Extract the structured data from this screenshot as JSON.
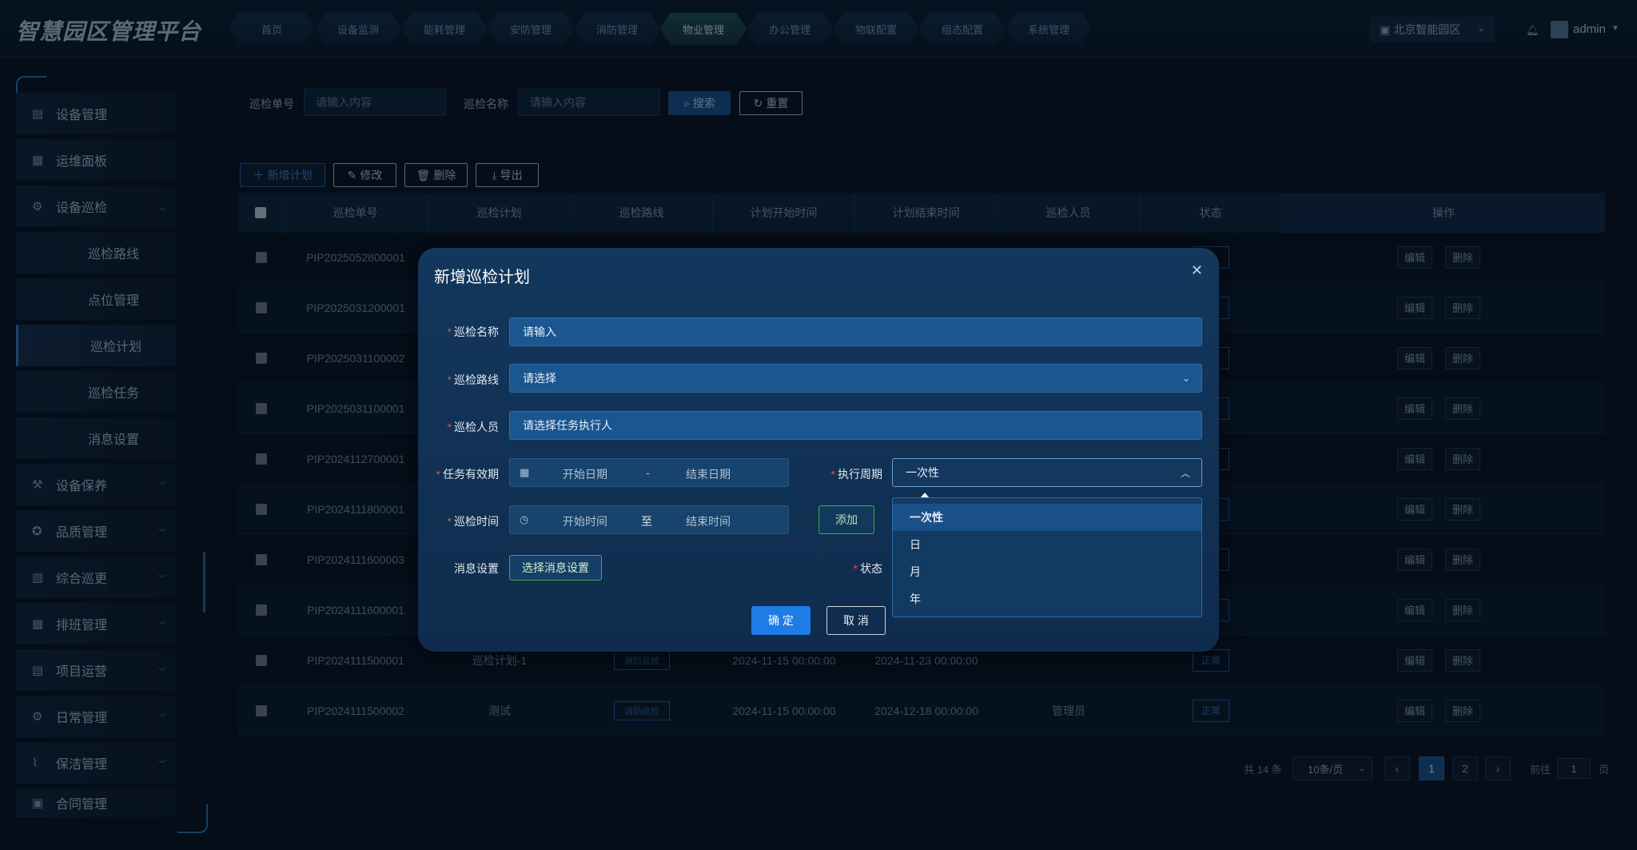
{
  "app": {
    "title": "智慧园区管理平台"
  },
  "nav": {
    "tabs": [
      "首页",
      "设备监测",
      "能耗管理",
      "安防管理",
      "消防管理",
      "物业管理",
      "办公管理",
      "物联配置",
      "组态配置",
      "系统管理"
    ],
    "active_index": 5
  },
  "header": {
    "region": "北京智能园区",
    "user": "admin"
  },
  "sidebar": {
    "items": [
      {
        "label": "设备管理",
        "icon": "server-icon"
      },
      {
        "label": "运维面板",
        "icon": "chart-icon"
      },
      {
        "label": "设备巡检",
        "icon": "gear-icon"
      },
      {
        "label": "巡检路线"
      },
      {
        "label": "点位管理"
      },
      {
        "label": "巡检计划"
      },
      {
        "label": "巡检任务"
      },
      {
        "label": "消息设置"
      },
      {
        "label": "设备保养",
        "icon": "wrench-icon"
      },
      {
        "label": "品质管理",
        "icon": "badge-icon"
      },
      {
        "label": "综合巡更",
        "icon": "building-icon"
      },
      {
        "label": "排班管理",
        "icon": "calendar-icon"
      },
      {
        "label": "项目运营",
        "icon": "chart-icon"
      },
      {
        "label": "日常管理",
        "icon": "cog-icon"
      },
      {
        "label": "保洁管理",
        "icon": "broom-icon"
      },
      {
        "label": "合同管理",
        "icon": "contract-icon"
      }
    ]
  },
  "filters": {
    "code_label": "巡检单号",
    "code_placeholder": "请输入内容",
    "name_label": "巡检名称",
    "name_placeholder": "请输入内容",
    "search": "搜索",
    "reset": "重置"
  },
  "toolbar": {
    "add": "新增计划",
    "edit": "修改",
    "delete": "删除",
    "export": "导出"
  },
  "table": {
    "headers": [
      "巡检单号",
      "巡检计划",
      "巡检路线",
      "计划开始时间",
      "计划结束时间",
      "巡检人员",
      "状态",
      "操作"
    ],
    "rows": [
      {
        "code": "PIP2025052800001"
      },
      {
        "code": "PIP2025031200001"
      },
      {
        "code": "PIP2025031100002"
      },
      {
        "code": "PIP2025031100001"
      },
      {
        "code": "PIP2024112700001"
      },
      {
        "code": "PIP2024111800001"
      },
      {
        "code": "PIP2024111600003"
      },
      {
        "code": "PIP2024111600001"
      },
      {
        "code": "PIP2024111500001",
        "plan": "巡检计划-1",
        "route": "消防巡检",
        "start": "2024-11-15 00:00:00",
        "end": "2024-11-23 00:00:00",
        "person": "",
        "status": "正常"
      },
      {
        "code": "PIP2024111500002",
        "plan": "测试",
        "route": "消防巡检",
        "start": "2024-11-15 00:00:00",
        "end": "2024-12-18 00:00:00",
        "person": "管理员",
        "status": "正常"
      }
    ],
    "op_edit": "编辑",
    "op_delete": "删除"
  },
  "pagination": {
    "total": "共 14 条",
    "page_size": "10条/页",
    "pages": [
      "1",
      "2"
    ],
    "goto_label": "前往",
    "goto_value": "1",
    "page_suffix": "页"
  },
  "modal": {
    "title": "新增巡检计划",
    "name_label": "巡检名称",
    "name_placeholder": "请输入",
    "route_label": "巡检路线",
    "route_placeholder": "请选择",
    "person_label": "巡检人员",
    "person_placeholder": "请选择任务执行人",
    "validity_label": "任务有效期",
    "start_date": "开始日期",
    "date_sep": "-",
    "end_date": "结束日期",
    "period_label": "执行周期",
    "period_value": "一次性",
    "time_label": "巡检时间",
    "start_time": "开始时间",
    "time_sep": "至",
    "end_time": "结束时间",
    "add": "添加",
    "msg_label": "消息设置",
    "msg_button": "选择消息设置",
    "status_label": "状态",
    "ok": "确 定",
    "cancel": "取 消",
    "period_options": [
      "一次性",
      "日",
      "月",
      "年"
    ]
  }
}
